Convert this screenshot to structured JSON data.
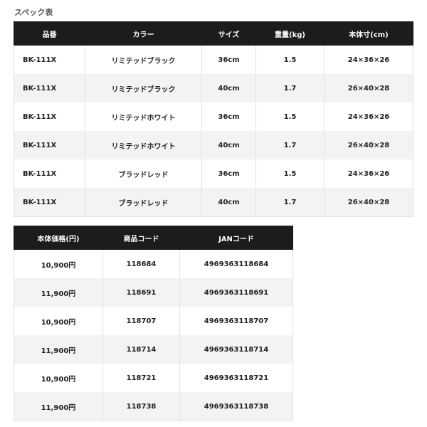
{
  "caption": "スペック表",
  "spec_table": {
    "headers": [
      "品番",
      "カラー",
      "サイズ",
      "重量(kg)",
      "本体寸(cm)"
    ],
    "rows": [
      [
        "BK-111X",
        "リミテッドブラック",
        "36cm",
        "1.5",
        "24×36×26"
      ],
      [
        "BK-111X",
        "リミテッドブラック",
        "40cm",
        "1.7",
        "26×40×28"
      ],
      [
        "BK-111X",
        "リミテッドホワイト",
        "36cm",
        "1.5",
        "24×36×26"
      ],
      [
        "BK-111X",
        "リミテッドホワイト",
        "40cm",
        "1.7",
        "26×40×28"
      ],
      [
        "BK-111X",
        "ブラッドレッド",
        "36cm",
        "1.5",
        "24×36×26"
      ],
      [
        "BK-111X",
        "ブラッドレッド",
        "40cm",
        "1.7",
        "26×40×28"
      ]
    ]
  },
  "price_table": {
    "headers": [
      "本体価格(円)",
      "商品コード",
      "JANコード"
    ],
    "rows": [
      [
        "10,900円",
        "118684",
        "4969363118684"
      ],
      [
        "11,900円",
        "118691",
        "4969363118691"
      ],
      [
        "10,900円",
        "118707",
        "4969363118707"
      ],
      [
        "11,900円",
        "118714",
        "4969363118714"
      ],
      [
        "10,900円",
        "118721",
        "4969363118721"
      ],
      [
        "11,900円",
        "118738",
        "4969363118738"
      ]
    ]
  }
}
